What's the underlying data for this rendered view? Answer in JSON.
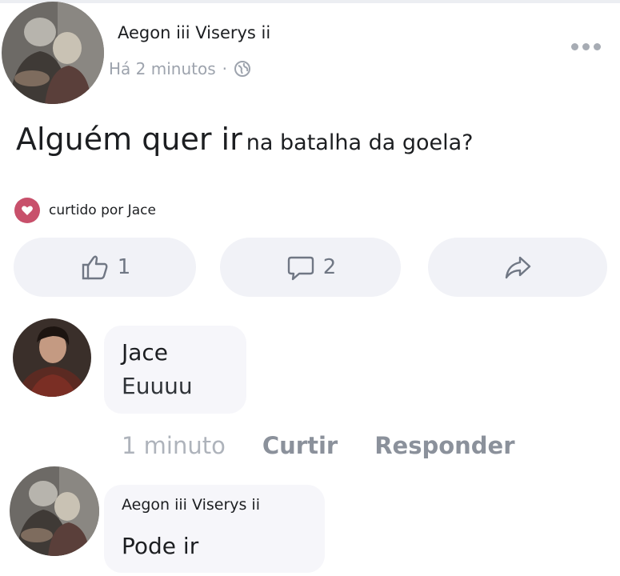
{
  "post": {
    "author": "Aegon iii Viserys ii",
    "time": "Há 2 minutos",
    "separator": "·",
    "text_part1": "Alguém quer ir",
    "text_part2": "na batalha da goela?",
    "liked_by": "curtido por Jace",
    "reactions": {
      "like_count": "1",
      "comment_count": "2"
    }
  },
  "comments": [
    {
      "author": "Jace",
      "text": "Euuuu",
      "time": "1 minuto",
      "like_label": "Curtir",
      "reply_label": "Responder"
    },
    {
      "author": "Aegon iii Viserys ii",
      "text": "Pode ir"
    }
  ],
  "icons": {
    "more": "more-icon",
    "globe": "globe-icon",
    "heart": "heart-icon",
    "like": "thumbs-up-icon",
    "comment": "comment-icon",
    "share": "share-icon"
  },
  "colors": {
    "heart_badge": "#c8506b",
    "pill_bg": "#f1f2f7",
    "bubble_bg": "#f6f6fa",
    "muted_text": "#9da3ad"
  }
}
